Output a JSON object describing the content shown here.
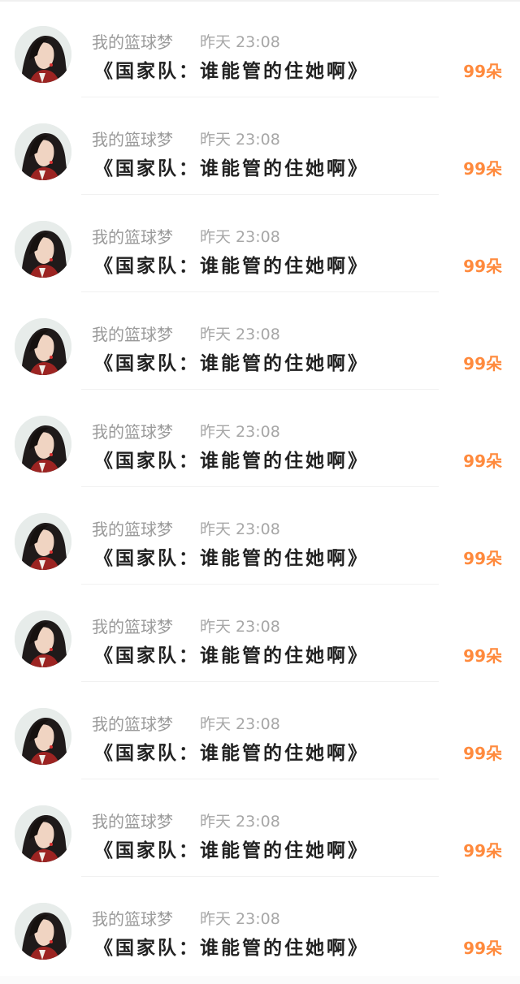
{
  "colors": {
    "accent": "#ff8a3d",
    "muted_text": "#9a9a9a",
    "primary_text": "#222222"
  },
  "items": [
    {
      "username": "我的篮球梦",
      "time": "昨天 23:08",
      "title": "《国家队：谁能管的住她啊》",
      "count": "99朵",
      "avatar_icon": "avatar-portrait"
    },
    {
      "username": "我的篮球梦",
      "time": "昨天 23:08",
      "title": "《国家队：谁能管的住她啊》",
      "count": "99朵",
      "avatar_icon": "avatar-portrait"
    },
    {
      "username": "我的篮球梦",
      "time": "昨天 23:08",
      "title": "《国家队：谁能管的住她啊》",
      "count": "99朵",
      "avatar_icon": "avatar-portrait"
    },
    {
      "username": "我的篮球梦",
      "time": "昨天 23:08",
      "title": "《国家队：谁能管的住她啊》",
      "count": "99朵",
      "avatar_icon": "avatar-portrait"
    },
    {
      "username": "我的篮球梦",
      "time": "昨天 23:08",
      "title": "《国家队：谁能管的住她啊》",
      "count": "99朵",
      "avatar_icon": "avatar-portrait"
    },
    {
      "username": "我的篮球梦",
      "time": "昨天 23:08",
      "title": "《国家队：谁能管的住她啊》",
      "count": "99朵",
      "avatar_icon": "avatar-portrait"
    },
    {
      "username": "我的篮球梦",
      "time": "昨天 23:08",
      "title": "《国家队：谁能管的住她啊》",
      "count": "99朵",
      "avatar_icon": "avatar-portrait"
    },
    {
      "username": "我的篮球梦",
      "time": "昨天 23:08",
      "title": "《国家队：谁能管的住她啊》",
      "count": "99朵",
      "avatar_icon": "avatar-portrait"
    },
    {
      "username": "我的篮球梦",
      "time": "昨天 23:08",
      "title": "《国家队：谁能管的住她啊》",
      "count": "99朵",
      "avatar_icon": "avatar-portrait"
    },
    {
      "username": "我的篮球梦",
      "time": "昨天 23:08",
      "title": "《国家队：谁能管的住她啊》",
      "count": "99朵",
      "avatar_icon": "avatar-portrait"
    }
  ]
}
